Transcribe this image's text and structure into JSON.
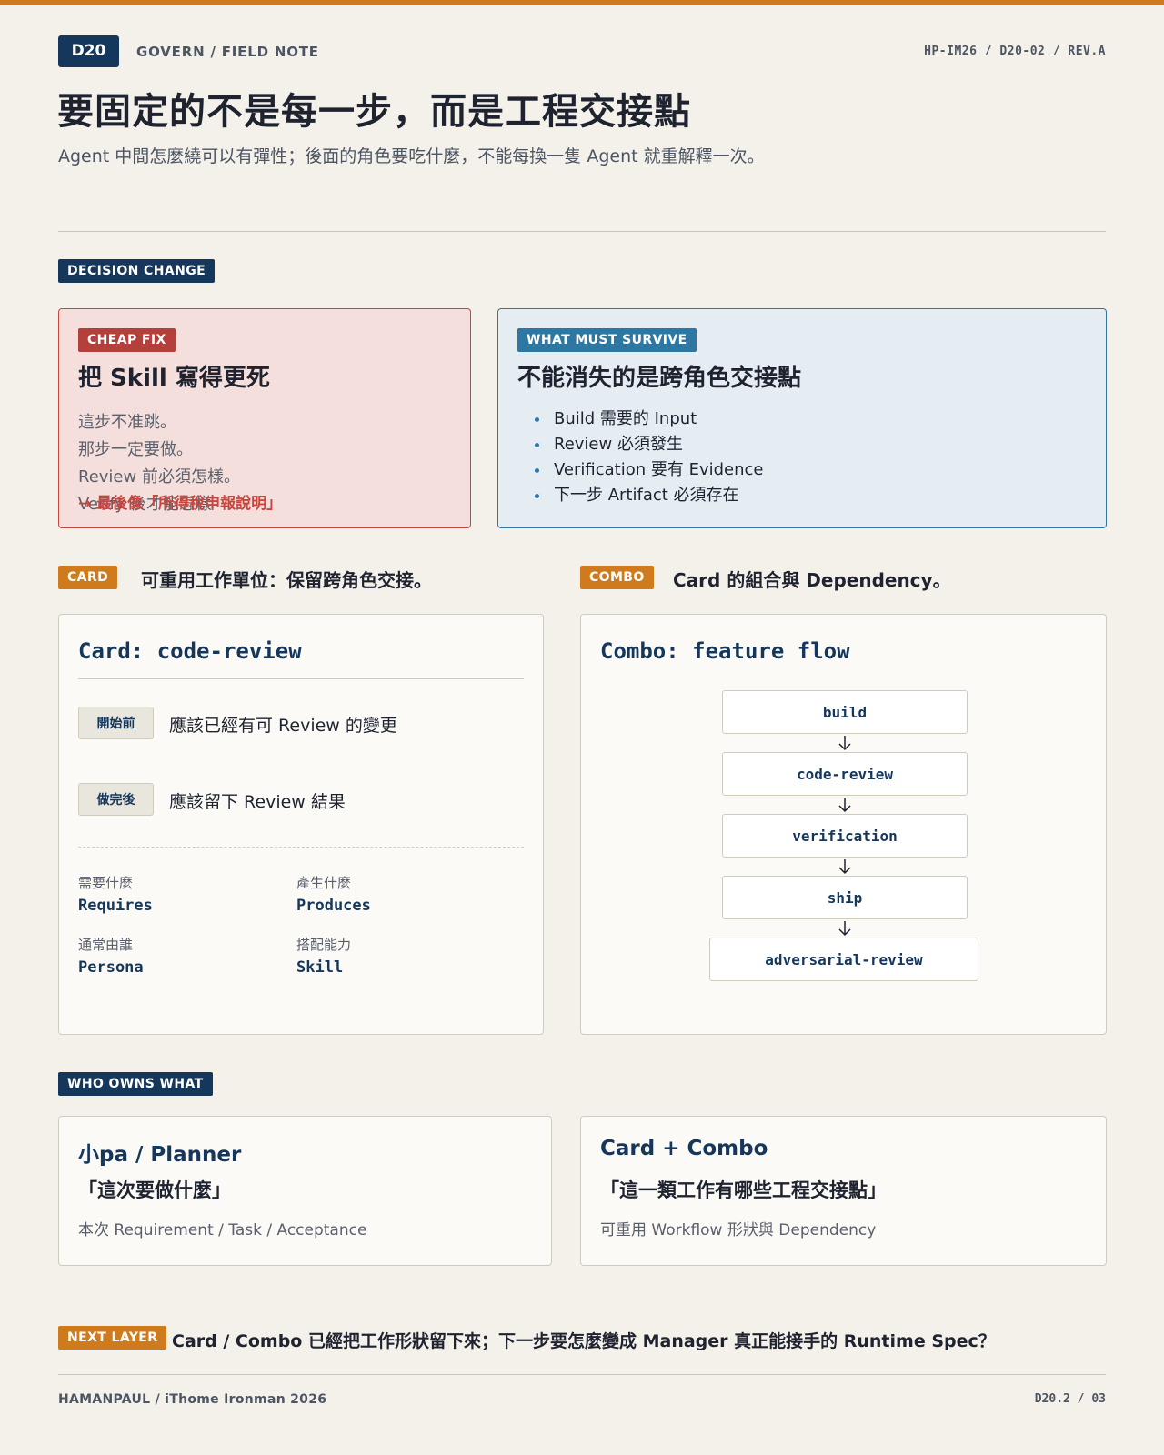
{
  "header": {
    "code": "D20",
    "breadcrumb": "GOVERN / FIELD NOTE",
    "doc_id": "HP-IM26 / D20-02 / REV.A",
    "title": "要固定的不是每一步，而是工程交接點",
    "subtitle": "Agent 中間怎麼繞可以有彈性；後面的角色要吃什麼，不能每換一隻 Agent 就重解釋一次。"
  },
  "decision": {
    "tag": "DECISION CHANGE",
    "cheap_fix": {
      "tag": "CHEAP FIX",
      "heading": "把 Skill 寫得更死",
      "lines": [
        "這步不准跳。",
        "那步一定要做。",
        "Review 前必須怎樣。",
        "Verify 後才能怎樣"
      ],
      "overlay": "→ 最後像「所得稅申報說明」"
    },
    "must_survive": {
      "tag": "WHAT MUST SURVIVE",
      "heading": "不能消失的是跨角色交接點",
      "items": [
        "Build 需要的 Input",
        "Review 必須發生",
        "Verification 要有 Evidence",
        "下一步 Artifact 必須存在"
      ]
    }
  },
  "card_section": {
    "tag": "CARD",
    "caption": "可重用工作單位：保留跨角色交接。",
    "title": "Card: code-review",
    "before": {
      "label": "開始前",
      "text": "應該已經有可 Review 的變更"
    },
    "after": {
      "label": "做完後",
      "text": "應該留下 Review 結果"
    },
    "meta": [
      {
        "label": "需要什麼",
        "value": "Requires"
      },
      {
        "label": "產生什麼",
        "value": "Produces"
      },
      {
        "label": "通常由誰",
        "value": "Persona"
      },
      {
        "label": "搭配能力",
        "value": "Skill"
      }
    ]
  },
  "combo_section": {
    "tag": "COMBO",
    "caption": "Card 的組合與 Dependency。",
    "title": "Combo: feature flow",
    "steps": [
      "build",
      "code-review",
      "verification",
      "ship",
      "adversarial-review"
    ]
  },
  "owners": {
    "tag": "WHO OWNS WHAT",
    "left": {
      "title": "小pa / Planner",
      "quote": "「這次要做什麼」",
      "desc": "本次 Requirement / Task / Acceptance"
    },
    "right": {
      "title": "Card + Combo",
      "quote": "「這一類工作有哪些工程交接點」",
      "desc": "可重用 Workflow 形狀與 Dependency"
    }
  },
  "next_layer": {
    "tag": "NEXT LAYER",
    "text": "Card / Combo 已經把工作形狀留下來；下一步要怎麼變成 Manager 真正能接手的 Runtime Spec？"
  },
  "footer": {
    "left": "HAMANPAUL / iThome Ironman 2026",
    "right": "D20.2 / 03"
  },
  "colors": {
    "accent": "#cf7a1c",
    "navy": "#16375c",
    "cheap_fix_red": "#c9463f",
    "survive_teal": "#2f77a3"
  }
}
